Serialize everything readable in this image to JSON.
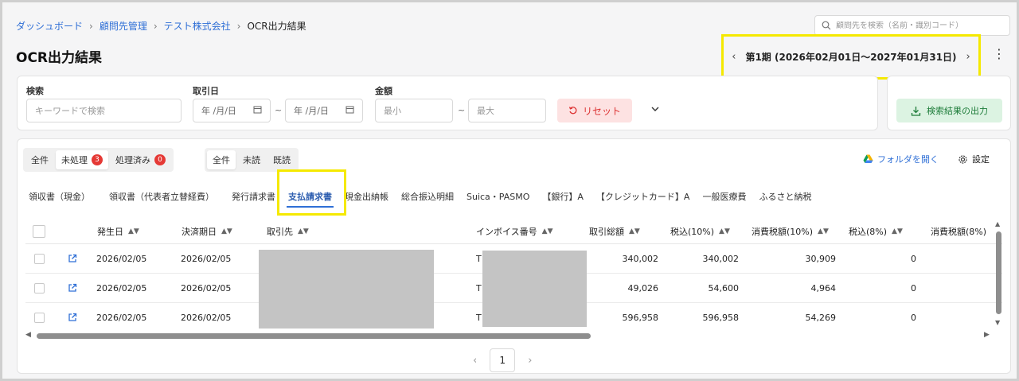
{
  "breadcrumb": [
    "ダッシュボード",
    "顧問先管理",
    "テスト株式会社",
    "OCR出力結果"
  ],
  "search": {
    "placeholder": "顧問先を検索（名前・識別コード）"
  },
  "page_title": "OCR出力結果",
  "period": {
    "label": "第1期 (2026年02月01日〜2027年01月31日)",
    "prev": "‹",
    "next": "›"
  },
  "filters": {
    "keyword_label": "検索",
    "keyword_placeholder": "キーワードで検索",
    "date_label": "取引日",
    "date_placeholder": "年 /月/日",
    "amount_label": "金額",
    "amount_min_placeholder": "最小",
    "amount_max_placeholder": "最大",
    "range_sep": "~",
    "reset_label": "リセット"
  },
  "export_label": "検索結果の出力",
  "status_tabs": [
    {
      "label": "全件",
      "count": ""
    },
    {
      "label": "未処理",
      "count": "3"
    },
    {
      "label": "処理済み",
      "count": "0"
    }
  ],
  "read_tabs": [
    "全件",
    "未読",
    "既読"
  ],
  "folder_label": "フォルダを開く",
  "settings_label": "設定",
  "doc_tabs": [
    "領収書（現金）",
    "領収書（代表者立替経費）",
    "発行請求書",
    "支払請求書",
    "現金出納帳",
    "総合振込明細",
    "Suica・PASMO",
    "【銀行】A",
    "【クレジットカード】A",
    "一般医療費",
    "ふるさと納税"
  ],
  "active_doc_tab": "支払請求書",
  "columns": [
    "発生日",
    "決済期日",
    "取引先",
    "インボイス番号",
    "取引総額",
    "税込(10%)",
    "消費税額(10%)",
    "税込(8%)",
    "消費税額(8%)"
  ],
  "rows": [
    {
      "date": "2026/02/05",
      "due": "2026/02/05",
      "invoice_prefix": "T",
      "total": "340,002",
      "tax10_incl": "340,002",
      "tax10": "30,909",
      "tax8_incl": "0"
    },
    {
      "date": "2026/02/05",
      "due": "2026/02/05",
      "invoice_prefix": "T",
      "total": "49,026",
      "tax10_incl": "54,600",
      "tax10": "4,964",
      "tax8_incl": "0"
    },
    {
      "date": "2026/02/05",
      "due": "2026/02/05",
      "invoice_prefix": "T",
      "total": "596,958",
      "tax10_incl": "596,958",
      "tax10": "54,269",
      "tax8_incl": "0"
    }
  ],
  "pagination": {
    "current": "1"
  },
  "colors": {
    "link": "#2f6fd6",
    "highlight": "#f5e900",
    "badge": "#e53935",
    "reset_bg": "#fde2e2",
    "export_bg": "#dcf3e2"
  }
}
